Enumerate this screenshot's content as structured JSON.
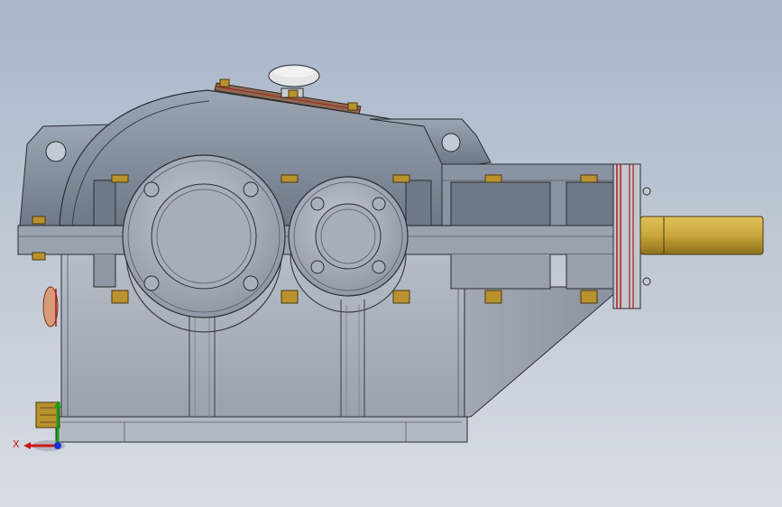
{
  "viewport": {
    "background_top": "#a9b6c9",
    "background_bottom": "#d8dde4",
    "model_name": ""
  },
  "model": {
    "type": "gear reducer assembly",
    "view": "front",
    "colors": {
      "housing_body": "#aeb4bf",
      "housing_dark": "#6f7684",
      "cover": "#8a93a2",
      "shaft": "#c9a63a",
      "bolts": "#b9922e",
      "seal_red": "#b01818",
      "plate": "#8a6a52"
    },
    "components": [
      "upper-housing-cover",
      "lower-housing-body",
      "bearing-cover-left",
      "bearing-cover-right",
      "output-shaft",
      "oil-filler-plug",
      "inspection-cover-plate",
      "oil-level-indicator",
      "drain-plug"
    ]
  },
  "triad": {
    "x_label": "X",
    "x_color": "#d01818",
    "y_color": "#18a018",
    "z_color": "#1830d0"
  }
}
